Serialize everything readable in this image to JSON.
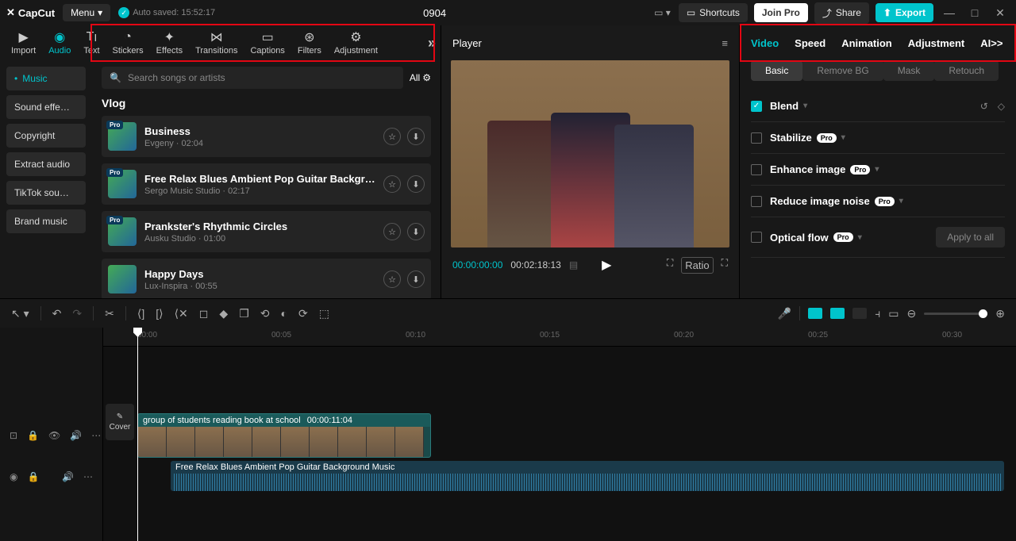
{
  "titlebar": {
    "logo": "CapCut",
    "menu": "Menu",
    "autosave": "Auto saved: 15:52:17",
    "project": "0904",
    "shortcuts": "Shortcuts",
    "joinpro": "Join Pro",
    "share": "Share",
    "export": "Export"
  },
  "mediaToolbar": {
    "items": [
      "Import",
      "Audio",
      "Text",
      "Stickers",
      "Effects",
      "Transitions",
      "Captions",
      "Filters",
      "Adjustment"
    ]
  },
  "categories": [
    "Music",
    "Sound effe…",
    "Copyright",
    "Extract audio",
    "TikTok sou…",
    "Brand music"
  ],
  "search": {
    "placeholder": "Search songs or artists",
    "all": "All"
  },
  "section": "Vlog",
  "tracks": [
    {
      "name": "Business",
      "artist": "Evgeny",
      "dur": "02:04",
      "pro": true
    },
    {
      "name": "Free Relax Blues Ambient Pop Guitar Background …",
      "artist": "Sergo Music Studio",
      "dur": "02:17",
      "pro": true
    },
    {
      "name": "Prankster's Rhythmic Circles",
      "artist": "Ausku Studio",
      "dur": "01:00",
      "pro": true
    },
    {
      "name": "Happy Days",
      "artist": "Lux-Inspira",
      "dur": "00:55",
      "pro": false
    }
  ],
  "player": {
    "title": "Player",
    "tc1": "00:00:00:00",
    "tc2": "00:02:18:13",
    "ratio": "Ratio"
  },
  "propsTabs": [
    "Video",
    "Speed",
    "Animation",
    "Adjustment",
    "AI>>"
  ],
  "subTabs": [
    "Basic",
    "Remove BG",
    "Mask",
    "Retouch"
  ],
  "props": [
    {
      "label": "Blend",
      "pro": false,
      "checked": true,
      "icons": true
    },
    {
      "label": "Stabilize",
      "pro": true,
      "checked": false
    },
    {
      "label": "Enhance image",
      "pro": true,
      "checked": false
    },
    {
      "label": "Reduce image noise",
      "pro": true,
      "checked": false
    },
    {
      "label": "Optical flow",
      "pro": true,
      "checked": false,
      "apply": "Apply to all"
    }
  ],
  "ruler": [
    "00:00",
    "00:05",
    "00:10",
    "00:15",
    "00:20",
    "00:25",
    "00:30"
  ],
  "clip": {
    "name": "group of students reading book at school",
    "dur": "00:00:11:04"
  },
  "audioClip": {
    "name": "Free Relax Blues Ambient Pop Guitar Background Music"
  },
  "cover": "Cover"
}
